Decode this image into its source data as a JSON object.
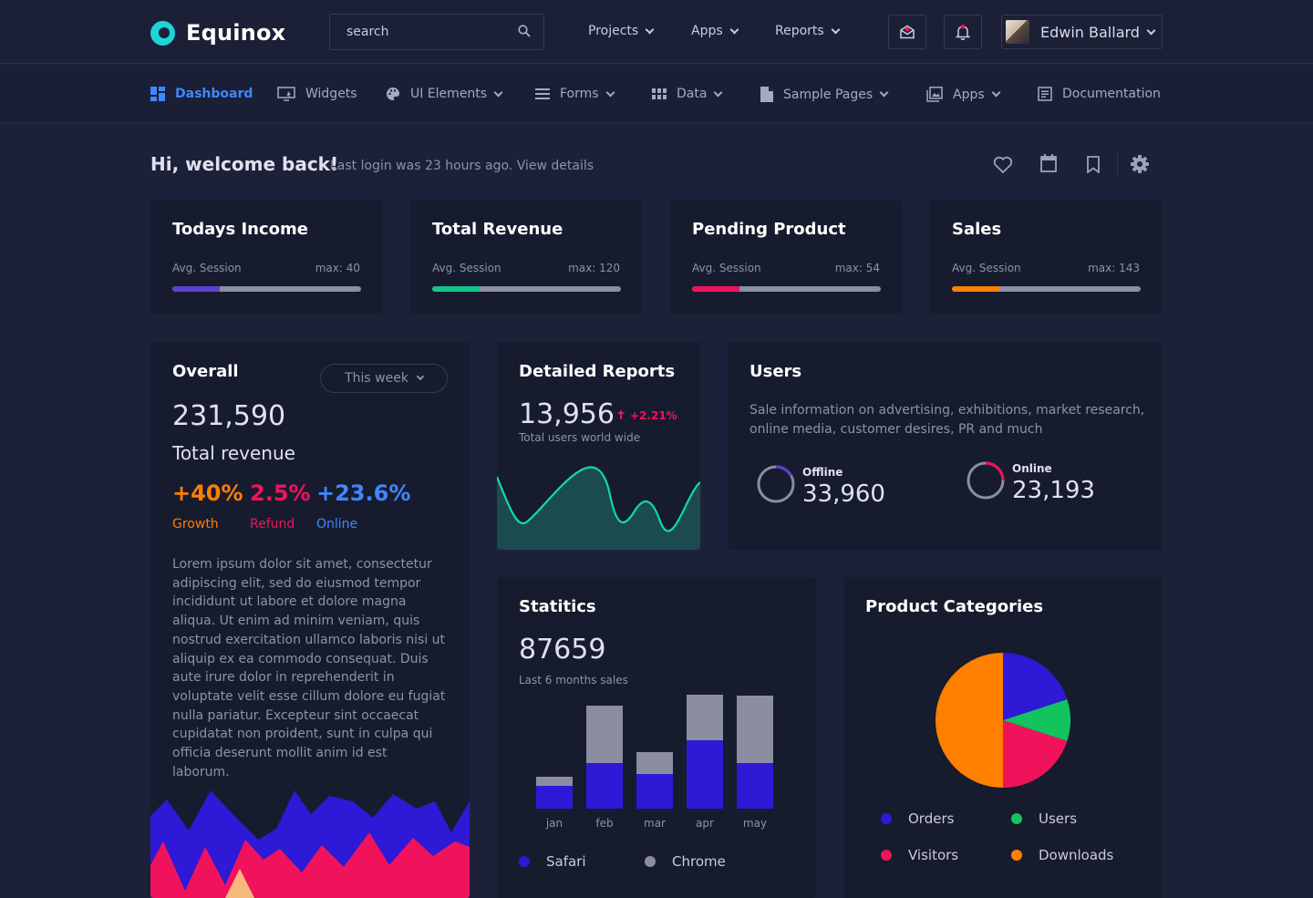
{
  "app": {
    "name": "Equinox"
  },
  "search": {
    "placeholder": "search"
  },
  "topnav": [
    {
      "label": "Projects"
    },
    {
      "label": "Apps"
    },
    {
      "label": "Reports"
    }
  ],
  "user": {
    "name": "Edwin Ballard"
  },
  "subnav": [
    {
      "label": "Dashboard",
      "icon": "dashboard-icon",
      "active": true
    },
    {
      "label": "Widgets",
      "icon": "monitor-icon"
    },
    {
      "label": "UI Elements",
      "icon": "palette-icon"
    },
    {
      "label": "Forms",
      "icon": "list-icon"
    },
    {
      "label": "Data",
      "icon": "grid-icon"
    },
    {
      "label": "Sample Pages",
      "icon": "file-icon"
    },
    {
      "label": "Apps",
      "icon": "gallery-icon"
    },
    {
      "label": "Documentation",
      "icon": "doc-icon"
    }
  ],
  "welcome": {
    "title": "Hi, welcome back!",
    "subtitle": "Last login was 23 hours ago. View details"
  },
  "stats": [
    {
      "title": "Todays Income",
      "label": "Avg. Session",
      "max": "max: 40",
      "color": "#5d3fd3",
      "progress": 0.25
    },
    {
      "title": "Total Revenue",
      "label": "Avg. Session",
      "max": "max: 120",
      "color": "#10c58b",
      "progress": 0.25
    },
    {
      "title": "Pending Product",
      "label": "Avg. Session",
      "max": "max: 54",
      "color": "#f0135c",
      "progress": 0.25
    },
    {
      "title": "Sales",
      "label": "Avg. Session",
      "max": "max: 143",
      "color": "#ff7f00",
      "progress": 0.25
    }
  ],
  "overall": {
    "title": "Overall",
    "dropdown": "This week",
    "value": "231,590",
    "label": "Total revenue",
    "metrics": [
      {
        "value": "+40%",
        "label": "Growth",
        "color": "#ff7f00"
      },
      {
        "value": "2.5%",
        "label": "Refund",
        "color": "#f0135c"
      },
      {
        "value": "+23.6%",
        "label": "Online",
        "color": "#3f87ff"
      }
    ],
    "text": "Lorem ipsum dolor sit amet, consectetur adipiscing elit, sed do eiusmod tempor incididunt ut labore et dolore magna aliqua. Ut enim ad minim veniam, quis nostrud exercitation ullamco laboris nisi ut aliquip ex ea commodo consequat. Duis aute irure dolor in reprehenderit in voluptate velit esse cillum dolore eu fugiat nulla pariatur. Excepteur sint occaecat cupidatat non proident, sunt in culpa qui officia deserunt mollit anim id est laborum."
  },
  "reports": {
    "title": "Detailed Reports",
    "value": "13,956",
    "change": "+2.21%",
    "subtitle": "Total users world wide"
  },
  "users": {
    "title": "Users",
    "text": "Sale information on advertising, exhibitions, market research, online media, customer desires, PR and much",
    "offline": {
      "label": "Offline",
      "value": "33,960"
    },
    "online": {
      "label": "Online",
      "value": "23,193"
    }
  },
  "statistics": {
    "title": "Statitics",
    "value": "87659",
    "subtitle": "Last 6 months sales"
  },
  "categories": {
    "title": "Product Categories"
  },
  "chart_data": [
    {
      "type": "bar",
      "stacked": true,
      "categories": [
        "jan",
        "feb",
        "mar",
        "apr",
        "may"
      ],
      "series": [
        {
          "name": "Safari",
          "color": "#2d19d6",
          "values": [
            25,
            50,
            38,
            75,
            50
          ]
        },
        {
          "name": "Chrome",
          "color": "#8b8ea3",
          "values": [
            10,
            63,
            24,
            50,
            74
          ]
        }
      ],
      "ylim": [
        0,
        130
      ]
    },
    {
      "type": "pie",
      "slices": [
        {
          "name": "Orders",
          "color": "#2d19d6",
          "value": 20
        },
        {
          "name": "Users",
          "color": "#12c35e",
          "value": 10
        },
        {
          "name": "Visitors",
          "color": "#f0135c",
          "value": 20
        },
        {
          "name": "Downloads",
          "color": "#ff7f00",
          "value": 50
        }
      ]
    }
  ]
}
